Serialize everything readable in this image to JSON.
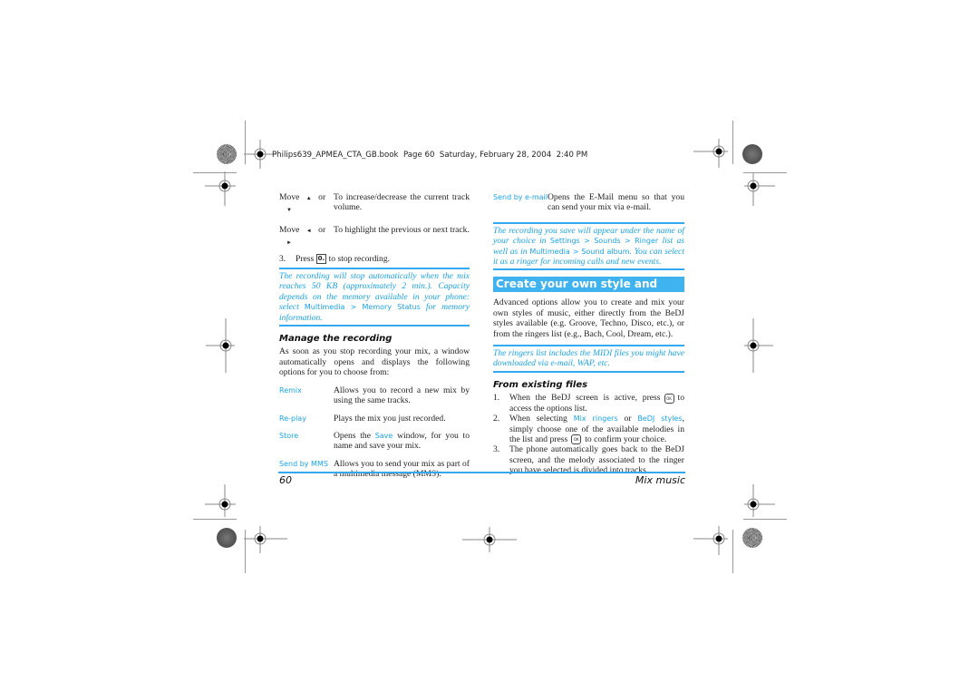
{
  "print_header": "Philips639_APMEA_CTA_GB.book  Page 60  Saturday, February 28, 2004  2:40 PM",
  "left_column": {
    "move_rows": [
      {
        "label": "Move",
        "keys": [
          "▲",
          "▼"
        ],
        "connector": "or",
        "text": "To increase/decrease the current track volume."
      },
      {
        "label": "Move",
        "keys": [
          "◄",
          "►"
        ],
        "connector": "or",
        "text": "To highlight the previous or next track."
      }
    ],
    "step3": {
      "num": "3.",
      "pre": "Press",
      "key": "0.",
      "post": "to stop recording."
    },
    "note1": {
      "part1": "The recording will stop automatically when the mix reaches 50 KB (approximately 2 min.). Capacity depends on the memory available in your phone: select ",
      "menu": "Multimedia > Memory Status",
      "part2": " for memory information."
    },
    "heading": "Manage the recording",
    "intro": "As soon as you stop recording your mix, a window automatically opens and displays the following options for you to choose from:",
    "options": [
      {
        "label": "Remix",
        "text": "Allows you to record a new mix by using the same tracks."
      },
      {
        "label": "Re-play",
        "text": "Plays the mix you just recorded."
      },
      {
        "label": "Store",
        "text_pre": "Opens the ",
        "inline": "Save",
        "text_post": " window, for you to name and save your mix."
      },
      {
        "label": "Send by MMS",
        "text": "Allows you to send your mix as part of a multimedia message (MMS)."
      }
    ]
  },
  "right_column": {
    "email_option": {
      "label": "Send by e-mail",
      "text": "Opens the E-Mail menu so that you can send your mix via e-mail."
    },
    "note2": {
      "p1": "The recording you save will appear under the name of your choice in ",
      "m1": "Settings > Sounds > Ringer",
      "p2": " list as well as in ",
      "m2": "Multimedia > Sound album",
      "p3": ". You can select it as a ringer for incoming calls and new events."
    },
    "section_title": "Create your own style and mix",
    "section_intro": "Advanced options allow you to create and mix your own styles of music, either directly from the BeDJ styles available (e.g. Groove, Techno, Disco, etc.), or from the ringers list (e.g., Bach, Cool, Dream, etc.).",
    "note3": "The ringers list includes the MIDI files you might have downloaded via e-mail, WAP, etc.",
    "subheading": "From existing files",
    "steps": [
      {
        "num": "1.",
        "pre": "When the BeDJ screen is active, press",
        "key": "OK",
        "post": "to access the options list."
      },
      {
        "num": "2.",
        "pre": "When selecting ",
        "m1": "Mix ringers",
        "mid": " or ",
        "m2": "BeDJ styles",
        "post1": ", simply choose one of the available melodies in the list and press",
        "key": "OK",
        "post2": "to confirm your choice."
      },
      {
        "num": "3.",
        "text": "The phone automatically goes back to the BeDJ screen, and the melody associated to the ringer you have selected is divided into tracks."
      }
    ]
  },
  "footer": {
    "page_number": "60",
    "chapter": "Mix music"
  }
}
